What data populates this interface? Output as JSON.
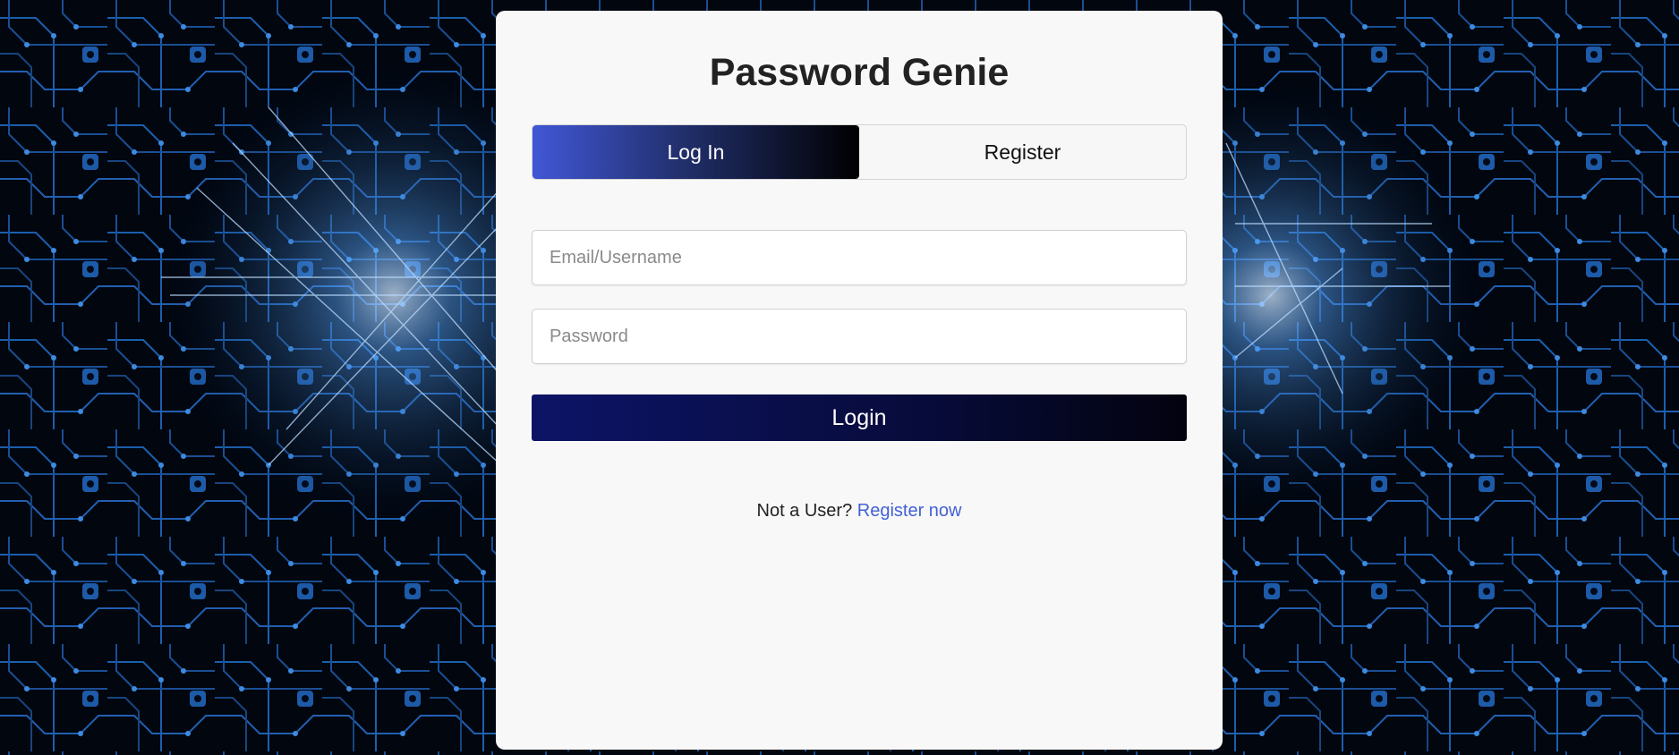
{
  "app": {
    "title": "Password Genie"
  },
  "tabs": [
    {
      "label": "Log In",
      "active": true
    },
    {
      "label": "Register",
      "active": false
    }
  ],
  "form": {
    "email_placeholder": "Email/Username",
    "email_value": "",
    "password_placeholder": "Password",
    "password_value": "",
    "submit_label": "Login"
  },
  "footer": {
    "prompt": "Not a User?",
    "link_label": "Register now"
  },
  "colors": {
    "tab_gradient_start": "#4157d6",
    "tab_gradient_end": "#000000",
    "button_gradient_start": "#0d1466",
    "button_gradient_end": "#03030f",
    "link": "#4260d6",
    "card_background": "#f8f8f8",
    "page_background": "circuit-board-blue"
  }
}
